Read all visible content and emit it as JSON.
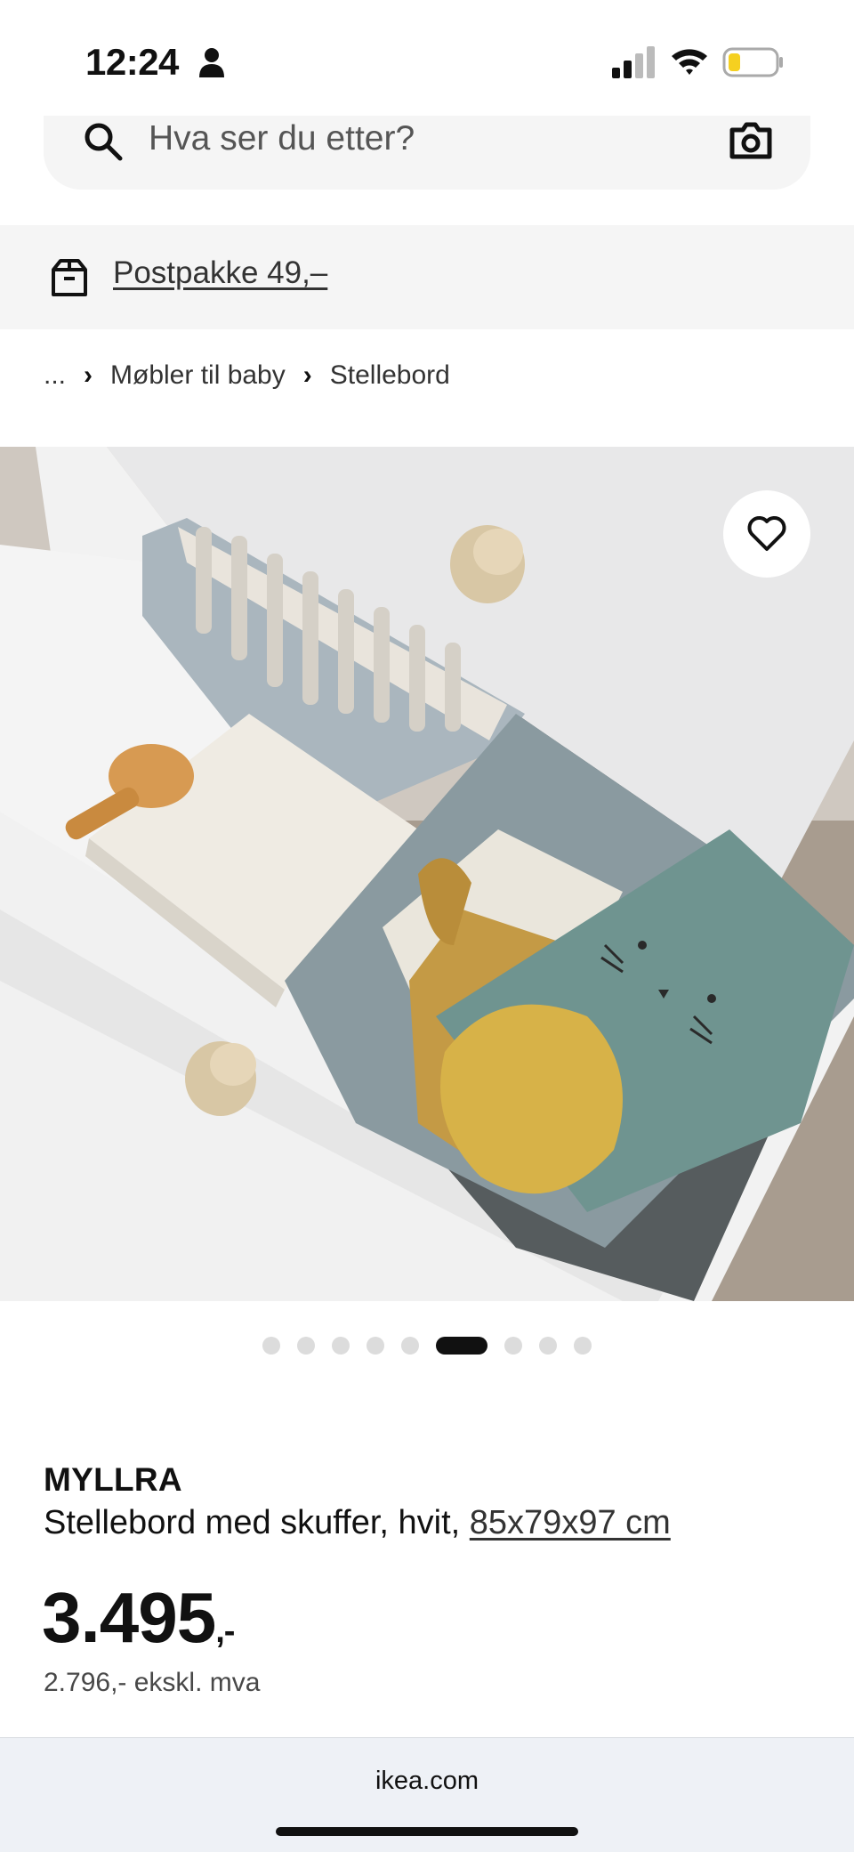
{
  "status_bar": {
    "time": "12:24"
  },
  "search": {
    "placeholder": "Hva ser du etter?"
  },
  "shipping": {
    "label": "Postpakke 49,–"
  },
  "breadcrumb": {
    "ellipsis": "...",
    "items": [
      "Møbler til baby",
      "Stellebord"
    ]
  },
  "carousel": {
    "total": 9,
    "active_index": 5
  },
  "product": {
    "name": "MYLLRA",
    "description": "Stellebord med skuffer, hvit,",
    "size": "85x79x97 cm",
    "price": "3.495",
    "price_suffix": ",-",
    "price_ex_vat": "2.796,- ekskl. mva"
  },
  "browser": {
    "url": "ikea.com"
  },
  "icons": [
    "person-icon",
    "signal-icon",
    "wifi-icon",
    "battery-icon",
    "search-icon",
    "camera-icon",
    "box-icon",
    "chevron-right-icon",
    "heart-icon"
  ],
  "colors": {
    "banner_bg": "#f5f5f5",
    "text": "#111111",
    "battery_fill": "#f5d020"
  }
}
